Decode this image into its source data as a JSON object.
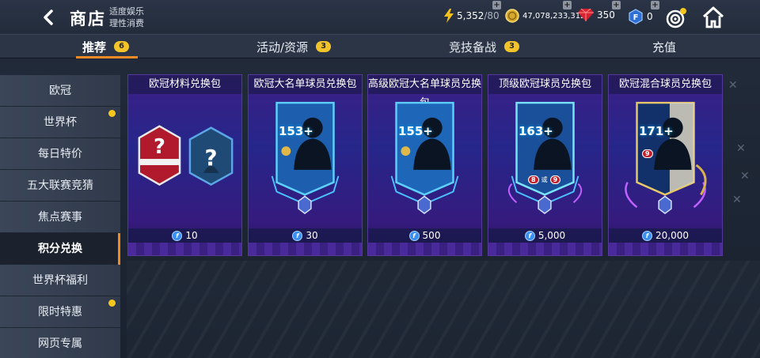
{
  "header": {
    "title": "商店",
    "slogan_line1": "适度娱乐",
    "slogan_line2": "理性消费",
    "energy": "5,352",
    "energy_max": "/80",
    "coins": "47,078,233,312",
    "gems": "350",
    "fifa_points": "0"
  },
  "tabs": [
    {
      "label": "推荐",
      "badge": "6"
    },
    {
      "label": "活动/资源",
      "badge": "3"
    },
    {
      "label": "竞技备战",
      "badge": "3"
    },
    {
      "label": "充值",
      "badge": ""
    }
  ],
  "sidebar": {
    "items": [
      {
        "label": "欧冠"
      },
      {
        "label": "世界杯"
      },
      {
        "label": "每日特价"
      },
      {
        "label": "五大联赛竞猜"
      },
      {
        "label": "焦点赛事"
      },
      {
        "label": "积分兑换"
      },
      {
        "label": "世界杯福利"
      },
      {
        "label": "限时特惠"
      },
      {
        "label": "网页专属"
      }
    ]
  },
  "cards": [
    {
      "title": "欧冠材料兑换包",
      "price": "10",
      "ovr": "",
      "mark_left": "?",
      "mark_right": "?"
    },
    {
      "title": "欧冠大名单球员兑换包",
      "price": "30",
      "ovr": "153+"
    },
    {
      "title": "高级欧冠大名单球员兑换包",
      "price": "500",
      "ovr": "155+"
    },
    {
      "title": "顶级欧冠球员兑换包",
      "price": "5,000",
      "ovr": "163+",
      "rank_a": "8",
      "rank_or": "或",
      "rank_b": "9"
    },
    {
      "title": "欧冠混合球员兑换包",
      "price": "20,000",
      "ovr": "171+",
      "rank_a": "9"
    }
  ],
  "colors": {
    "accent": "#f08a24",
    "badge": "#f3c42a",
    "card_bg": "#2a2386"
  }
}
